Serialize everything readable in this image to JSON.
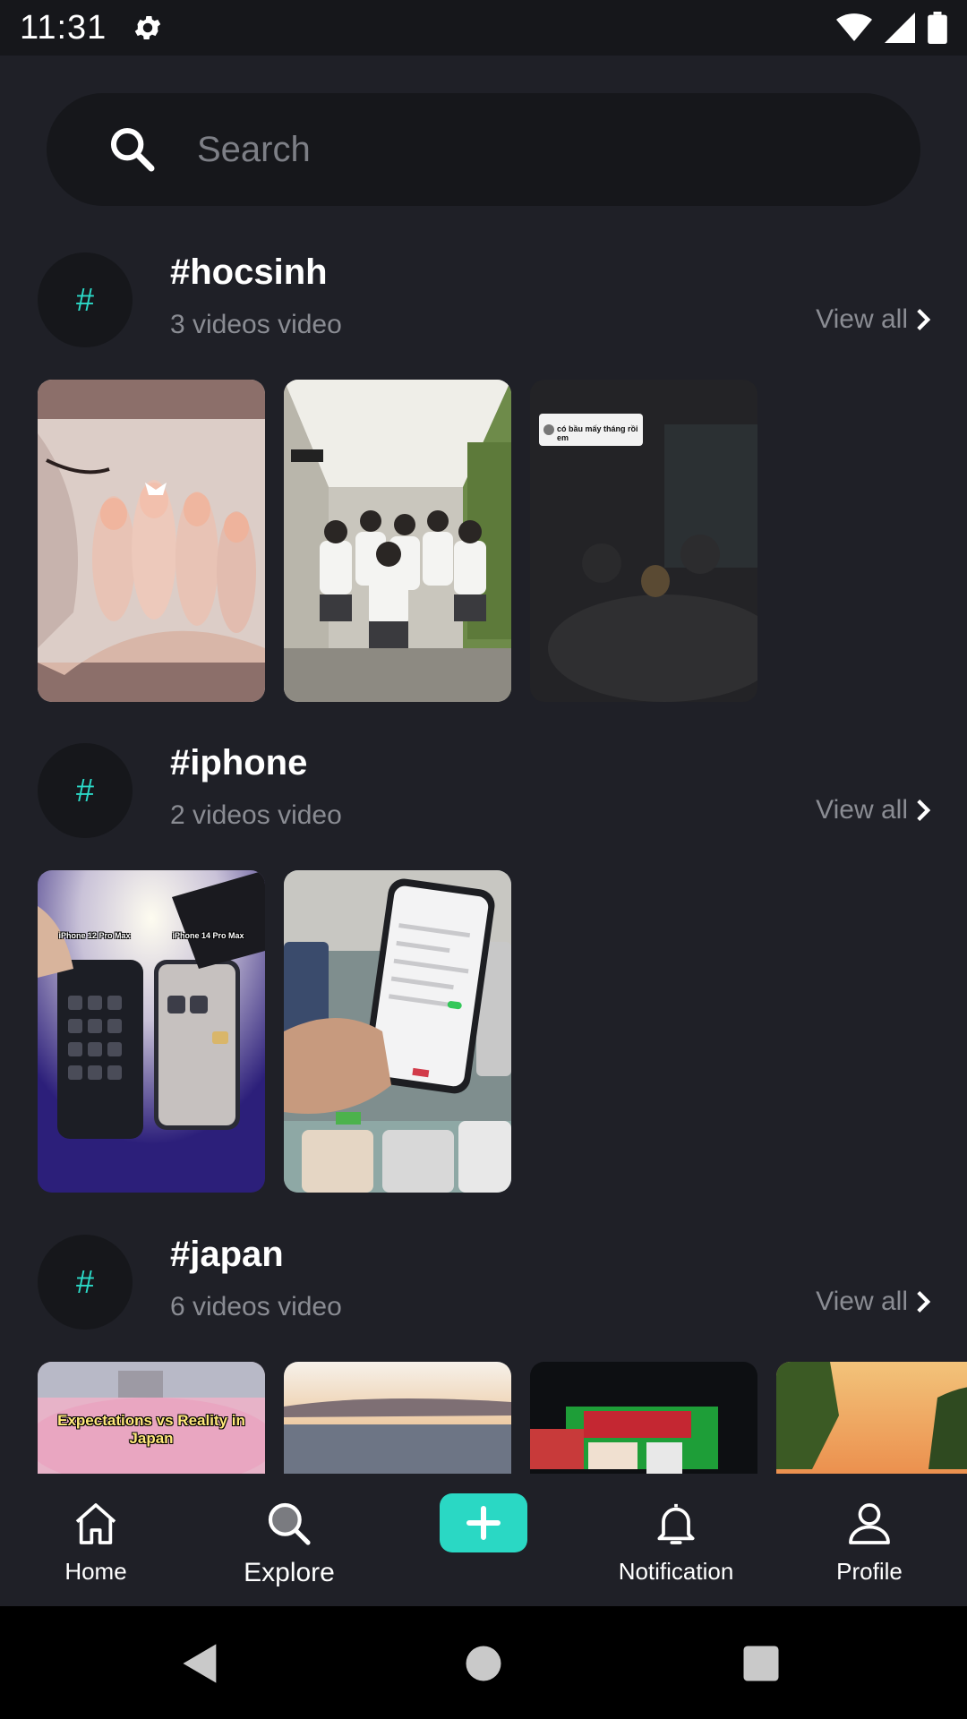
{
  "status_bar": {
    "time": "11:31"
  },
  "search": {
    "placeholder": "Search"
  },
  "sections": [
    {
      "tag": "#hocsinh",
      "count": "3 videos video",
      "view_all": "View all",
      "hash_symbol": "#"
    },
    {
      "tag": "#iphone",
      "count": "2 videos video",
      "view_all": "View all",
      "hash_symbol": "#"
    },
    {
      "tag": "#japan",
      "count": "6 videos video",
      "view_all": "View all",
      "hash_symbol": "#"
    }
  ],
  "thumb_captions": {
    "iphone_left": "iPhone 12 Pro Max",
    "iphone_right": "iPhone 14 Pro Max",
    "japan_1": "Expectations vs Reality in Japan",
    "dark_overlay": "có bầu mấy tháng rồi em"
  },
  "bottom_nav": {
    "home": "Home",
    "explore": "Explore",
    "notification": "Notification",
    "profile": "Profile"
  },
  "colors": {
    "accent": "#2ad8c4",
    "background": "#1f2027",
    "surface": "#16171b"
  },
  "icons": [
    "gear-icon",
    "wifi-icon",
    "signal-icon",
    "battery-icon",
    "search-icon",
    "chevron-right-icon",
    "home-icon",
    "plus-icon",
    "bell-icon",
    "person-icon",
    "back-icon",
    "home-circle-icon",
    "recents-icon"
  ]
}
